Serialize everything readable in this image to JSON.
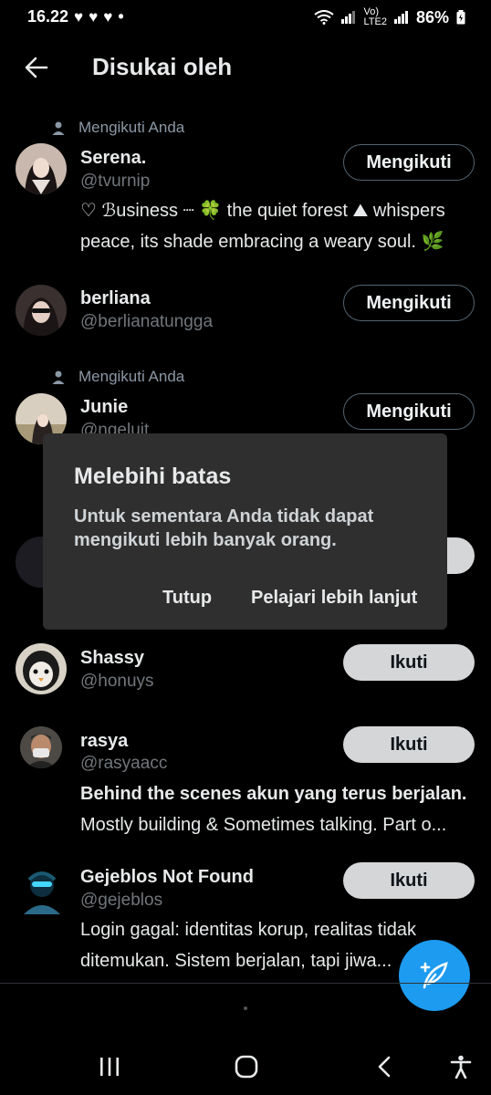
{
  "status": {
    "time": "16.22",
    "notif_icons": [
      "heart-icon",
      "heart-icon",
      "heart-icon"
    ],
    "dot": "•",
    "network_small": "Vo)\nLTE2",
    "battery": "86%"
  },
  "header": {
    "back_icon": "arrow-left-icon",
    "title": "Disukai oleh"
  },
  "users": [
    {
      "context": "Mengikuti Anda",
      "name": "Serena.",
      "handle": "@tvurnip",
      "bio_line1": "♡ ℬusiness ┈ 🍀 the quiet forest ⛰ whispers",
      "bio_line2": "peace, its shade embracing a weary soul. 🌿",
      "button": "Mengikuti"
    },
    {
      "name": "berliana",
      "handle": "@berlianatungga",
      "button": "Mengikuti"
    },
    {
      "context": "Mengikuti Anda",
      "name": "Junie",
      "handle": "@ngeluit",
      "button": "Mengikuti"
    },
    {
      "name": "Shassy",
      "handle": "@honuys",
      "button": "Ikuti"
    },
    {
      "name": "rasya",
      "handle": "@rasyaacc",
      "bio_line1": "Behind the scenes akun yang terus berjalan.",
      "bio_line2": "Mostly building & Sometimes talking. Part o...",
      "button": "Ikuti"
    },
    {
      "name": "Gejeblos Not Found",
      "handle": "@gejeblos",
      "bio_line1": "Login gagal: identitas korup, realitas tidak",
      "bio_line2": "ditemukan. Sistem berjalan, tapi jiwa...",
      "button": "Ikuti"
    }
  ],
  "dialog": {
    "title": "Melebihi batas",
    "message": "Untuk sementara Anda tidak dapat mengikuti lebih banyak orang.",
    "close": "Tutup",
    "learn_more": "Pelajari lebih lanjut"
  },
  "fab": {
    "icon": "compose-post-icon"
  },
  "nav": {
    "recents_icon": "recents-icon",
    "home_icon": "home-icon",
    "back_icon": "back-chevron-icon",
    "accessibility_icon": "accessibility-icon"
  },
  "colors": {
    "background": "#000000",
    "accent": "#1d9bf0",
    "dialog_bg": "#2f2f2f",
    "muted_text": "#71767b"
  }
}
